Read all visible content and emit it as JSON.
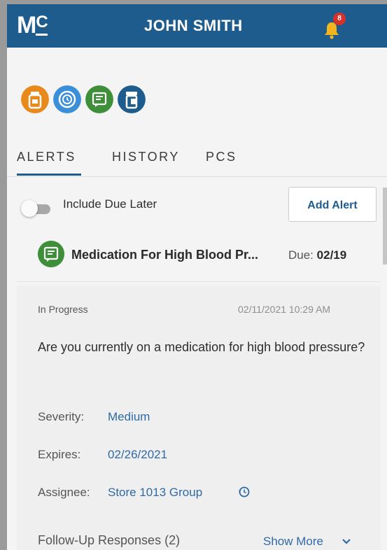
{
  "header": {
    "logo_main": "M",
    "logo_sub": "C",
    "user_name": "JOHN SMITH",
    "notification_count": "8",
    "bar_color": "#1f5c8e",
    "bell_color": "#f2b51d",
    "badge_color": "#d9302a"
  },
  "category_icons": [
    {
      "name": "medication-bottle-icon",
      "color": "#e8891c"
    },
    {
      "name": "clock-icon",
      "color": "#3b8fd8"
    },
    {
      "name": "clipboard-icon",
      "color": "#3f8f3a"
    },
    {
      "name": "pill-bottle-icon",
      "color": "#1f5c8e"
    }
  ],
  "tabs": [
    {
      "label": "ALERTS",
      "active": true
    },
    {
      "label": "HISTORY",
      "active": false
    },
    {
      "label": "PCS",
      "active": false
    }
  ],
  "controls": {
    "include_due_later_label": "Include Due Later",
    "include_due_later_on": false,
    "add_alert_label": "Add Alert"
  },
  "alert": {
    "icon": "clipboard-icon",
    "title": "Medication For High Blood Pr...",
    "due_label": "Due:",
    "due_value": "02/19",
    "status": "In Progress",
    "timestamp": "02/11/2021 10:29 AM",
    "question": "Are you currently on a medication for high blood pressure?",
    "severity_label": "Severity:",
    "severity_value": "Medium",
    "expires_label": "Expires:",
    "expires_value": "02/26/2021",
    "assignee_label": "Assignee:",
    "assignee_value": "Store 1013 Group",
    "followup_label": "Follow-Up Responses (2)",
    "show_more_label": "Show More"
  }
}
